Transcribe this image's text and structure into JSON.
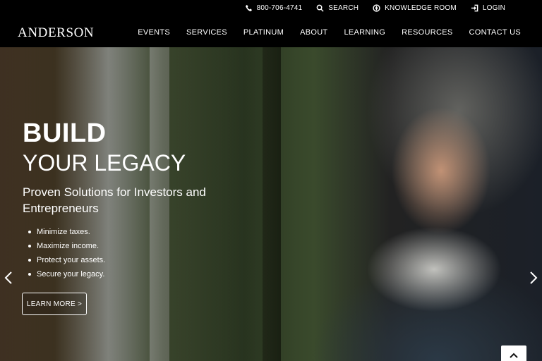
{
  "utility_nav": {
    "phone": "800-706-4741",
    "search": "SEARCH",
    "knowledge_room": "KNOWLEDGE ROOM",
    "login": "LOGIN"
  },
  "logo": "ANDERSON",
  "main_nav": [
    "EVENTS",
    "SERVICES",
    "PLATINUM",
    "ABOUT",
    "LEARNING",
    "RESOURCES",
    "CONTACT US"
  ],
  "hero": {
    "title_line1": "BUILD",
    "title_line2": "YOUR LEGACY",
    "subtitle": "Proven Solutions for Investors and Entrepreneurs",
    "bullets": [
      "Minimize taxes.",
      "Maximize income.",
      "Protect your assets.",
      "Secure your legacy."
    ],
    "cta": "LEARN MORE >"
  },
  "icons": {
    "phone": "phone-icon",
    "search": "search-icon",
    "knowledge": "compass-icon",
    "login": "login-icon",
    "prev": "chevron-left-icon",
    "next": "chevron-right-icon",
    "top": "chevron-up-icon"
  }
}
